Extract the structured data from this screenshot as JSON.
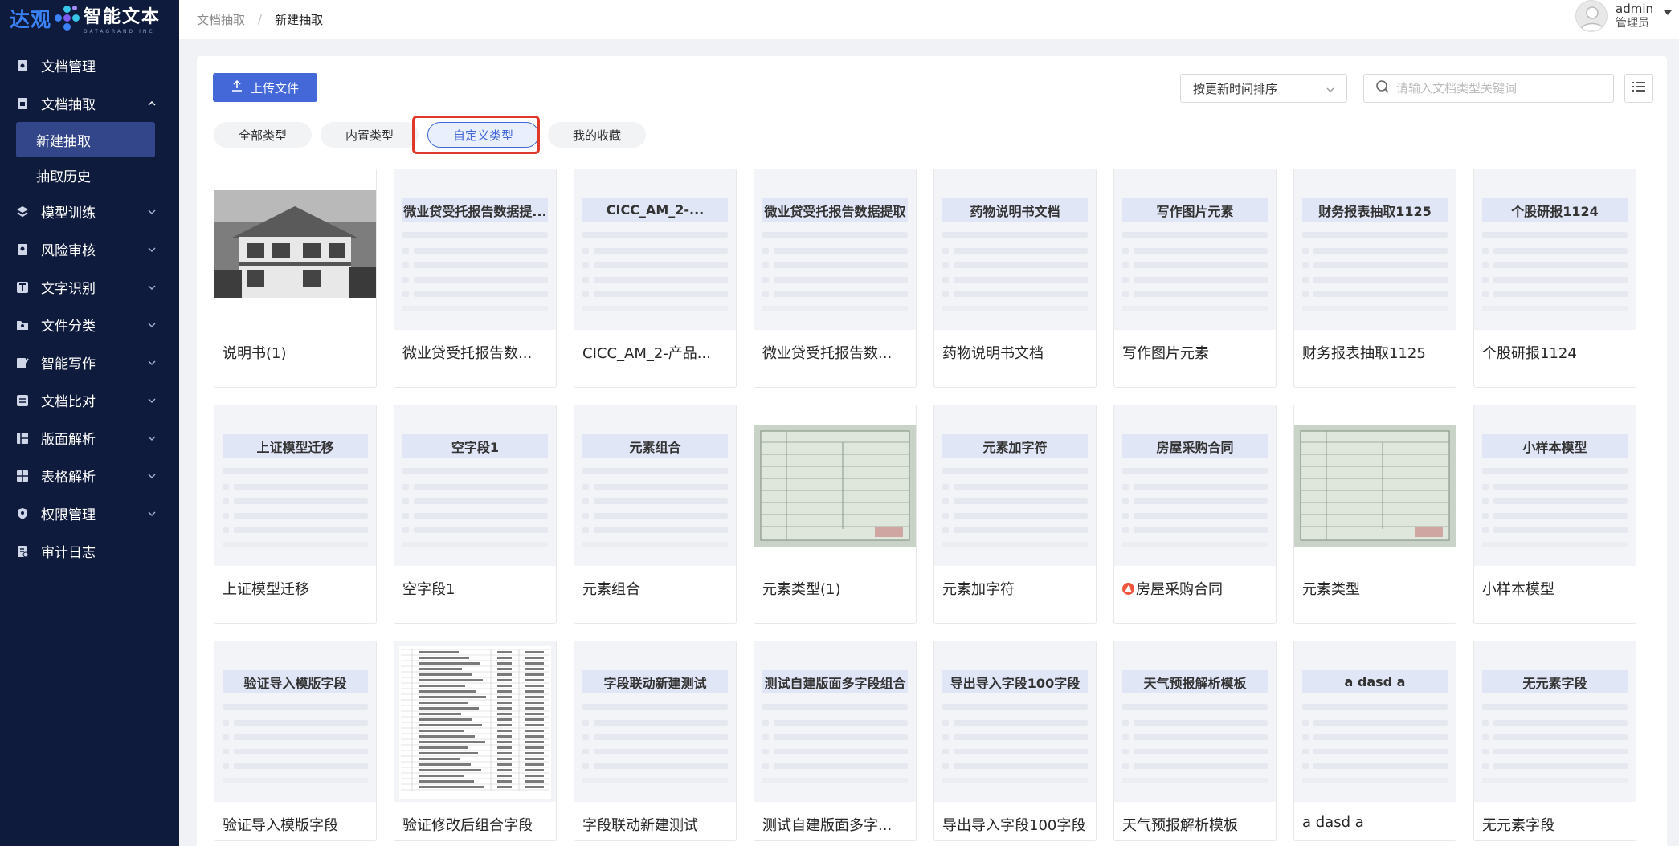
{
  "app": {
    "brand_cn": "达观",
    "brand_product": "智能文本",
    "brand_sub": "DATAGRAND INC"
  },
  "sidebar": {
    "items": [
      {
        "label": "文档管理",
        "icon": "doc-manage-icon",
        "expandable": false
      },
      {
        "label": "文档抽取",
        "icon": "doc-extract-icon",
        "expandable": true,
        "expanded": true,
        "children": [
          {
            "label": "新建抽取",
            "active": true
          },
          {
            "label": "抽取历史",
            "active": false
          }
        ]
      },
      {
        "label": "模型训练",
        "icon": "model-train-icon",
        "expandable": true
      },
      {
        "label": "风险审核",
        "icon": "risk-review-icon",
        "expandable": true
      },
      {
        "label": "文字识别",
        "icon": "ocr-icon",
        "expandable": true
      },
      {
        "label": "文件分类",
        "icon": "file-classify-icon",
        "expandable": true
      },
      {
        "label": "智能写作",
        "icon": "smart-write-icon",
        "expandable": true
      },
      {
        "label": "文档比对",
        "icon": "doc-compare-icon",
        "expandable": true
      },
      {
        "label": "版面解析",
        "icon": "layout-parse-icon",
        "expandable": true
      },
      {
        "label": "表格解析",
        "icon": "table-parse-icon",
        "expandable": true
      },
      {
        "label": "权限管理",
        "icon": "permission-icon",
        "expandable": true
      },
      {
        "label": "审计日志",
        "icon": "audit-log-icon",
        "expandable": false
      }
    ]
  },
  "header": {
    "breadcrumb": [
      "文档抽取",
      "/",
      "新建抽取"
    ],
    "user": {
      "name": "admin",
      "role": "管理员"
    }
  },
  "toolbar": {
    "upload_label": "上传文件",
    "sort_value": "按更新时间排序",
    "search_placeholder": "请输入文档类型关键词"
  },
  "tabs": [
    {
      "label": "全部类型",
      "active": false
    },
    {
      "label": "内置类型",
      "active": false
    },
    {
      "label": "自定义类型",
      "active": true
    },
    {
      "label": "我的收藏",
      "active": false
    }
  ],
  "cards": [
    {
      "thumb_title": "",
      "label": "说明书(1)",
      "thumb": "house-photo"
    },
    {
      "thumb_title": "微业贷受托报告数据提...",
      "label": "微业贷受托报告数..."
    },
    {
      "thumb_title": "CICC_AM_2-...",
      "label": "CICC_AM_2-产品..."
    },
    {
      "thumb_title": "微业贷受托报告数据提取",
      "label": "微业贷受托报告数..."
    },
    {
      "thumb_title": "药物说明书文档",
      "label": "药物说明书文档"
    },
    {
      "thumb_title": "写作图片元素",
      "label": "写作图片元素"
    },
    {
      "thumb_title": "财务报表抽取1125",
      "label": "财务报表抽取1125"
    },
    {
      "thumb_title": "个股研报1124",
      "label": "个股研报1124"
    },
    {
      "thumb_title": "上证模型迁移",
      "label": "上证模型迁移"
    },
    {
      "thumb_title": "空字段1",
      "label": "空字段1"
    },
    {
      "thumb_title": "元素组合",
      "label": "元素组合"
    },
    {
      "thumb_title": "",
      "label": "元素类型(1)",
      "thumb": "form-photo"
    },
    {
      "thumb_title": "元素加字符",
      "label": "元素加字符"
    },
    {
      "thumb_title": "房屋采购合同",
      "label": "房屋采购合同",
      "badge": true
    },
    {
      "thumb_title": "",
      "label": "元素类型",
      "thumb": "form-photo"
    },
    {
      "thumb_title": "小样本模型",
      "label": "小样本模型"
    },
    {
      "thumb_title": "验证导入模版字段",
      "label": "验证导入模版字段"
    },
    {
      "thumb_title": "",
      "label": "验证修改后组合字段",
      "thumb": "table-doc"
    },
    {
      "thumb_title": "字段联动新建测试",
      "label": "字段联动新建测试"
    },
    {
      "thumb_title": "测试自建版面多字段组合",
      "label": "测试自建版面多字..."
    },
    {
      "thumb_title": "导出导入字段100字段",
      "label": "导出导入字段100字段"
    },
    {
      "thumb_title": "天气预报解析模板",
      "label": "天气预报解析模板"
    },
    {
      "thumb_title": "a dasd a",
      "label": "a dasd a"
    },
    {
      "thumb_title": "无元素字段",
      "label": "无元素字段"
    }
  ],
  "colors": {
    "primary": "#4468d8",
    "sidebar_bg": "#0f1b3d",
    "highlight": "#e0382a"
  }
}
